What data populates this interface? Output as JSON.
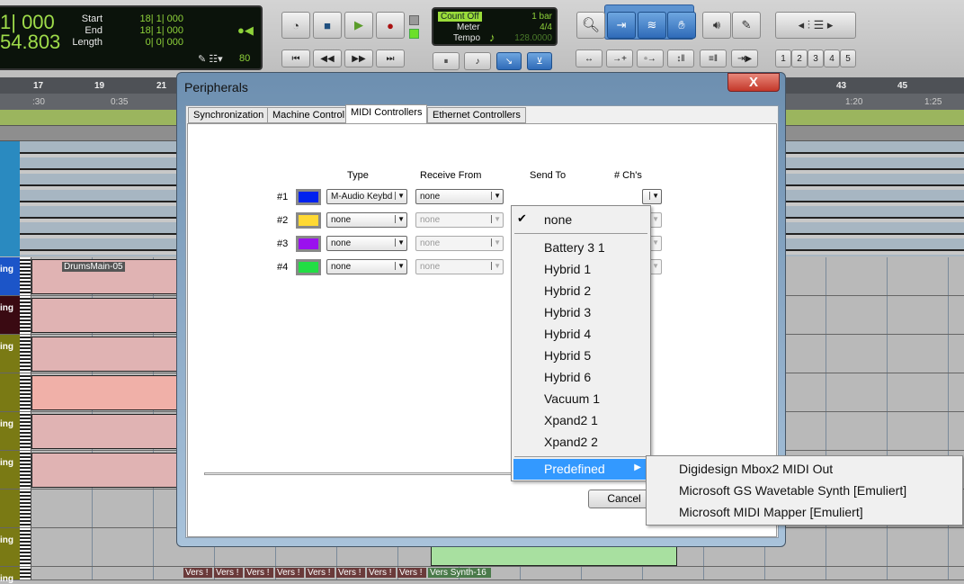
{
  "counter": {
    "main1": "1| 000",
    "main2": "54.803",
    "start_label": "Start",
    "end_label": "End",
    "length_label": "Length",
    "start": "18| 1| 000",
    "end": "18| 1| 000",
    "length": "0| 0| 000",
    "nudge": "80"
  },
  "count": {
    "count_off": "Count Off",
    "bars": "1 bar",
    "meter_label": "Meter",
    "meter": "4/4",
    "tempo_label": "Tempo",
    "tempo": "128.0000"
  },
  "grid_numbers": [
    "1",
    "2",
    "3",
    "4",
    "5"
  ],
  "ruler": {
    "bars": [
      "17",
      "19",
      "21",
      "43",
      "45"
    ],
    "times": [
      ":30",
      "0:35",
      "1:20",
      "1:25"
    ]
  },
  "tracks": [
    {
      "label": "ing",
      "color": "#1c55c8"
    },
    {
      "label": "ing",
      "color": "#3a0a12"
    },
    {
      "label": "ing",
      "color": "#7a7a14"
    },
    {
      "label": "",
      "color": "#7a7a14"
    },
    {
      "label": "ing",
      "color": "#7a7a14"
    },
    {
      "label": "ing",
      "color": "#7a7a14"
    },
    {
      "label": "",
      "color": "#7a7a14"
    },
    {
      "label": "ing",
      "color": "#7a7a14"
    },
    {
      "label": "ing",
      "color": "#7a7a14"
    }
  ],
  "regions": {
    "drums": "DrumsMain-05",
    "vers": [
      "Vers !",
      "Vers !",
      "Vers !",
      "Vers !",
      "Vers !",
      "Vers !",
      "Vers !",
      "Vers !"
    ],
    "synth": "Vers Synth-16"
  },
  "dialog": {
    "title": "Peripherals",
    "close": "X",
    "tabs": [
      "Synchronization",
      "Machine Control",
      "MIDI Controllers",
      "Ethernet Controllers"
    ],
    "columns": {
      "type": "Type",
      "receive": "Receive From",
      "send": "Send To",
      "chs": "# Ch's"
    },
    "rows": [
      {
        "num": "#1",
        "color": "#0022ee",
        "type": "M-Audio Keybd",
        "receive": "none"
      },
      {
        "num": "#2",
        "color": "#ffd933",
        "type": "none",
        "receive": "none"
      },
      {
        "num": "#3",
        "color": "#9a11ee",
        "type": "none",
        "receive": "none"
      },
      {
        "num": "#4",
        "color": "#22dd44",
        "type": "none",
        "receive": "none"
      }
    ],
    "cancel": "Cancel"
  },
  "menu": {
    "selected": "none",
    "items": [
      "Battery 3 1",
      "Hybrid 1",
      "Hybrid 2",
      "Hybrid 3",
      "Hybrid 4",
      "Hybrid 5",
      "Hybrid 6",
      "Vacuum 1",
      "Xpand2 1",
      "Xpand2 2"
    ],
    "predefined": "Predefined"
  },
  "submenu": [
    "Digidesign Mbox2 MIDI Out",
    "Microsoft GS Wavetable Synth [Emuliert]",
    "Microsoft MIDI Mapper [Emuliert]"
  ]
}
